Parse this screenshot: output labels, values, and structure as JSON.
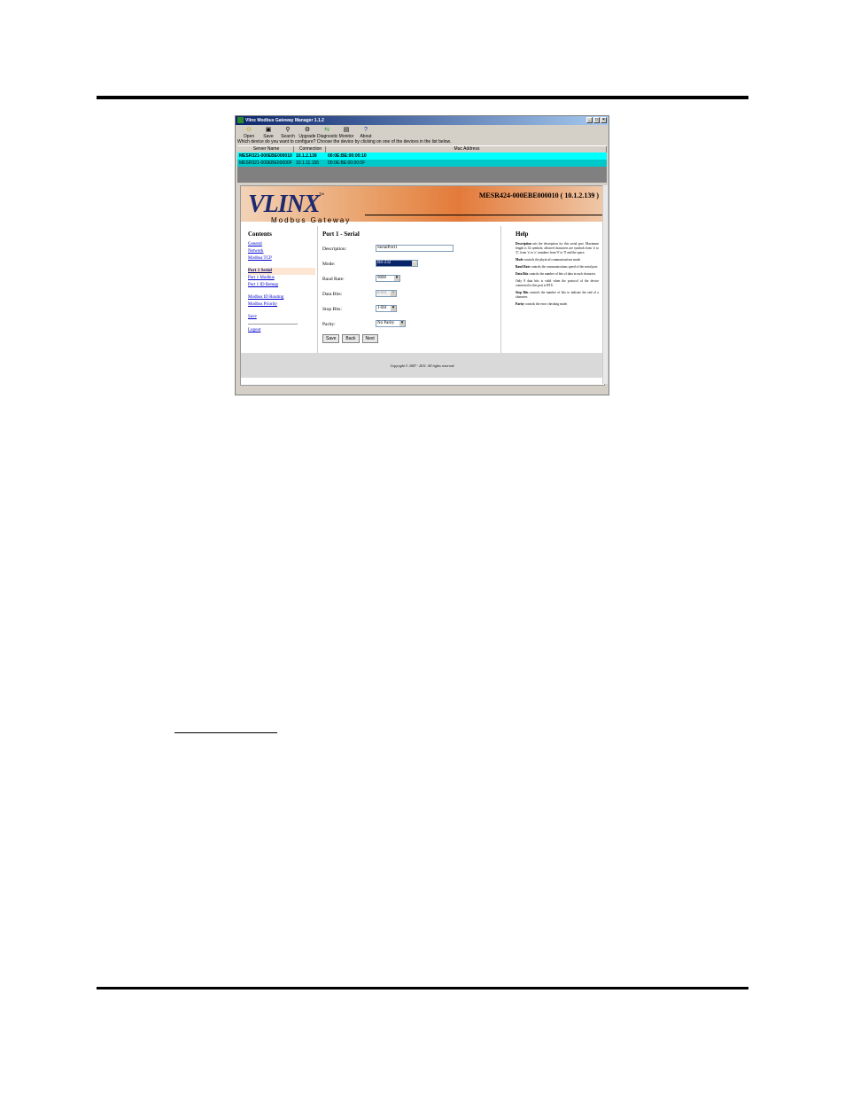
{
  "window": {
    "title": "Vlinx Modbus Gateway Manager 1.1.2",
    "controls": [
      "_",
      "□",
      "×"
    ]
  },
  "toolbar": {
    "items": [
      {
        "label": "Open",
        "icon": "open-icon"
      },
      {
        "label": "Save",
        "icon": "save-icon"
      },
      {
        "label": "Search",
        "icon": "search-icon"
      },
      {
        "label": "Upgrade",
        "icon": "upgrade-icon"
      },
      {
        "label": "Diagnostic",
        "icon": "diagnostic-icon"
      },
      {
        "label": "Monitor",
        "icon": "monitor-icon"
      },
      {
        "label": "About",
        "icon": "about-icon"
      }
    ]
  },
  "prompt": "Which device do you want to configure? Choose the device by clicking on one of the devices in the list below.",
  "device_table": {
    "columns": [
      "Server Name",
      "Connection",
      "Mac Address"
    ],
    "rows": [
      {
        "name": "MESR321-000EBE000010",
        "connection": "10.1.2.139",
        "mac": "00:0E:BE:00:00:10"
      },
      {
        "name": "MESR321-000EBE00000F",
        "connection": "10.1.11.155",
        "mac": "00:0E:BE:00:00:0F"
      }
    ]
  },
  "web": {
    "logo": "VLINX",
    "logo_tm": "TM",
    "logo_sub": "Modbus Gateway",
    "device_title": "MESR424-000EBE000010 ( 10.1.2.139 )",
    "nav": {
      "heading": "Contents",
      "items": [
        "General",
        "Network",
        "Modbus TCP",
        "Port 1 Serial",
        "Port 1 Modbus",
        "Port 1 ID Remap",
        "Modbus ID Routing",
        "Modbus Priority",
        "Save",
        "Logout"
      ]
    },
    "form": {
      "heading": "Port 1 - Serial",
      "description_label": "Description:",
      "description_value": "SerialPort1",
      "mode_label": "Mode:",
      "mode_value": "RS-232",
      "baud_label": "Baud Rate:",
      "baud_value": "9600",
      "databits_label": "Data Bits:",
      "databits_value": "8-Bit",
      "stopbits_label": "Stop Bits:",
      "stopbits_value": "1-Bit",
      "parity_label": "Parity:",
      "parity_value": "No Parity",
      "save": "Save",
      "back": "Back",
      "next": "Next"
    },
    "help": {
      "heading": "Help",
      "p1_term": "Description",
      "p1": "sets the description for this serial port. Maximum length is 32 symbols; allowed characters are symbols from 'a' to 'Z', from 'a' to 'z', numbers from '0' to '9' and the space.",
      "p2_term": "Mode",
      "p2": "controls the physical communications mode.",
      "p3_term": "Baud Rate",
      "p3": "controls the communications speed of the serial port.",
      "p4_term": "Data Bits",
      "p4": "controls the number of bits of data in each character.",
      "p5": "Only 8 data bits is valid when the protocol of the device connected to this port is RTU.",
      "p6_term": "Stop Bits",
      "p6": "controls the number of bits to indicate the end of a character.",
      "p7_term": "Parity",
      "p7": "controls the error checking mode."
    },
    "copyright": "Copyright © 2007 - 2011. All rights reserved."
  }
}
